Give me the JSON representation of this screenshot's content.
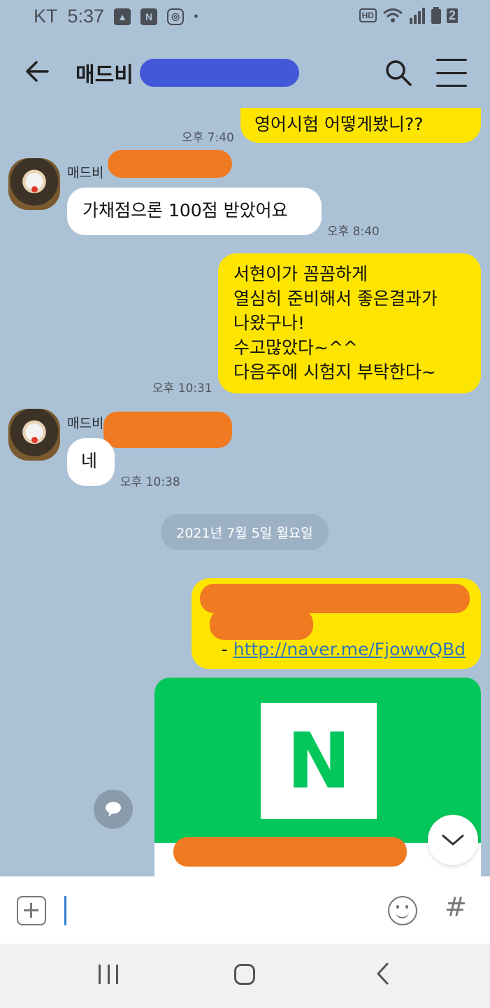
{
  "status_bar": {
    "carrier": "KT",
    "time": "5:37",
    "notif_n": "N",
    "hd": "HD",
    "battery": "2"
  },
  "header": {
    "title": "매드비"
  },
  "messages": [
    {
      "side": "me",
      "text": "영어시험 어떻게봤니??",
      "time": "오후 7:40"
    },
    {
      "side": "them",
      "sender": "매드비",
      "text": "가채점으론 100점 받았어요",
      "time": "오후 8:40"
    },
    {
      "side": "me",
      "lines": [
        "서현이가 꼼꼼하게",
        "열심히 준비해서 좋은결과가",
        "나왔구나!",
        "수고많았다~^^",
        "다음주에 시험지 부탁한다~"
      ],
      "time": "오후 10:31"
    },
    {
      "side": "them",
      "sender": "매드비",
      "text": "네",
      "time": "오후 10:38"
    }
  ],
  "date_divider": "2021년 7월 5일 월요일",
  "link_message": {
    "prefix": "- ",
    "url": "http://naver.me/FjowwQBd"
  },
  "preview_card": {
    "logo_letter": "N"
  },
  "input": {
    "placeholder": "",
    "hash": "#"
  },
  "colors": {
    "chat_bg": "#abc1d6",
    "my_bubble": "#fee500",
    "their_bubble": "#ffffff",
    "naver_green": "#03c75a"
  }
}
